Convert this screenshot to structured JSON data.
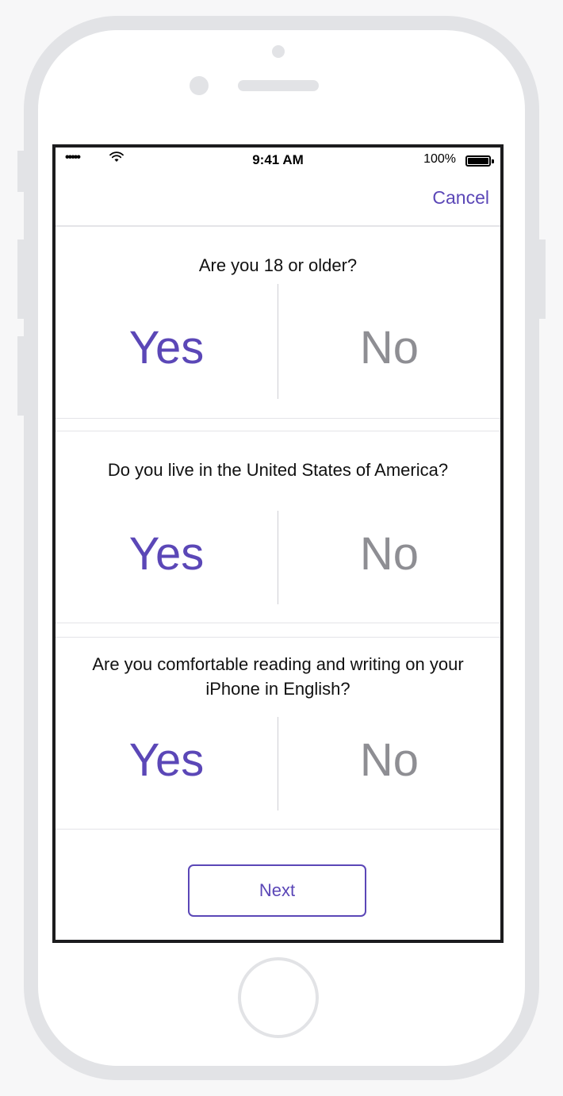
{
  "status_bar": {
    "signal": "•••••",
    "wifi_icon": "wifi-icon",
    "time": "9:41 AM",
    "battery_percent": "100%",
    "battery_level": 1.0
  },
  "nav": {
    "cancel_label": "Cancel"
  },
  "questions": [
    {
      "text": "Are you 18 or older?",
      "yes_label": "Yes",
      "no_label": "No"
    },
    {
      "text": "Do you live in the United States of America?",
      "yes_label": "Yes",
      "no_label": "No"
    },
    {
      "text": "Are you comfortable reading and writing on your iPhone in English?",
      "yes_label": "Yes",
      "no_label": "No"
    }
  ],
  "footer": {
    "next_label": "Next"
  },
  "colors": {
    "accent": "#5b47b7",
    "answer_inactive": "#8e8e93",
    "phone_frame": "#e2e3e6"
  }
}
